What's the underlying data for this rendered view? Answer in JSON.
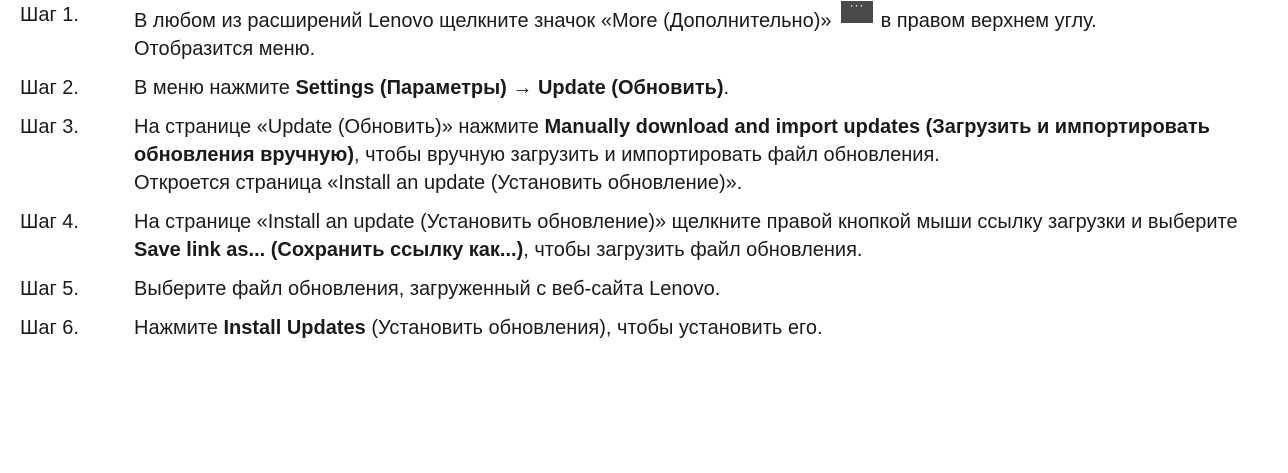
{
  "steps": [
    {
      "label": "Шаг 1.",
      "text_before_icon": "В любом из расширений Lenovo щелкните значок «More (Дополнительно)»",
      "icon": "more-icon",
      "icon_glyph": "···",
      "text_after_icon": "в правом верхнем углу.",
      "result": "Отобразится меню."
    },
    {
      "label": "Шаг 2.",
      "text_before": "В меню нажмите",
      "bold": "Settings (Параметры) → Update (Обновить)",
      "text_after": "."
    },
    {
      "label": "Шаг 3.",
      "text_before": "На странице «Update (Обновить)» нажмите",
      "bold": "Manually download and import updates (Загрузить и импортировать обновления вручную)",
      "text_after": ", чтобы вручную загрузить и импортировать файл обновления.",
      "result": "Откроется страница «Install an update (Установить обновление)»."
    },
    {
      "label": "Шаг 4.",
      "text_before": "На странице «Install an update (Установить обновление)» щелкните правой кнопкой мыши ссылку загрузки и выберите",
      "bold": "Save link as... (Сохранить ссылку как...)",
      "text_after": ", чтобы загрузить файл обновления."
    },
    {
      "label": "Шаг 5.",
      "text": "Выберите файл обновления, загруженный с веб-сайта Lenovo."
    },
    {
      "label": "Шаг 6.",
      "text_before": "Нажмите",
      "bold": "Install Updates",
      "text_after": " (Установить обновления), чтобы установить его."
    }
  ]
}
